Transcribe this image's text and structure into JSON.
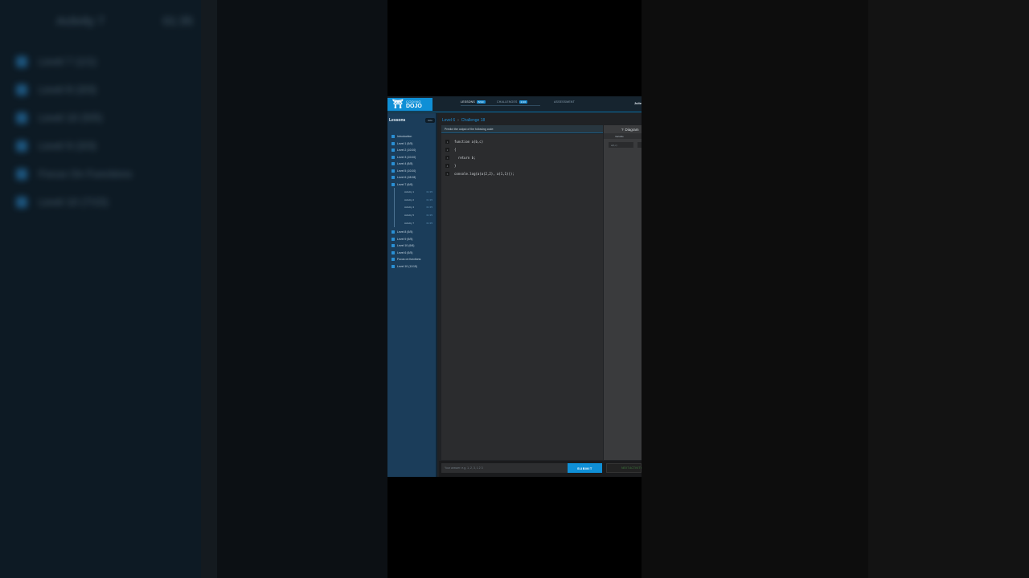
{
  "background_blur": {
    "title": "Activity 7",
    "title_time": "01:35",
    "items": [
      "Level 7 (1/1)",
      "Level 8 (3/3)",
      "Level 10 (5/5)",
      "Level 9 (3/3)",
      "Focus On Functions",
      "Level 10 (7/15)"
    ]
  },
  "header": {
    "logo_line1": "CODING",
    "logo_line2": "DOJO",
    "nav": [
      {
        "label": "LESSONS",
        "badge": "5/10"
      },
      {
        "label": "CHALLENGES",
        "badge": "1/10"
      },
      {
        "label": "ASSESSMENT",
        "badge": ""
      }
    ],
    "user": "Julie"
  },
  "sidebar": {
    "title": "Lessons",
    "pill": "Hide",
    "items": [
      "Introduction",
      "Level 1 (5/5)",
      "Level 2 (10/10)",
      "Level 3 (10/10)",
      "Level 4 (8/8)",
      "Level 5 (10/10)",
      "Level 6 (18/18)",
      "Level 7 (6/6)"
    ],
    "subitems": [
      {
        "label": "Activity 1",
        "time": "01:35"
      },
      {
        "label": "Activity 2",
        "time": "01:35"
      },
      {
        "label": "Activity 4",
        "time": "01:35"
      },
      {
        "label": "Activity 5",
        "time": "01:35"
      },
      {
        "label": "Activity 7",
        "time": "01:35"
      }
    ],
    "items_after": [
      "Level 8 (5/5)",
      "Level 9 (5/5)",
      "Level 10 (6/6)",
      "Level 6 (5/5)",
      "Focus on functions",
      "Level 10 (11/15)"
    ]
  },
  "main": {
    "breadcrumb": {
      "level": "Level 6",
      "separator": "›",
      "challenge": "Challenge 18"
    },
    "prompt": "Predict the output of the following code:",
    "code": [
      {
        "n": "1",
        "text": "function a(b,c)"
      },
      {
        "n": "2",
        "text": "{"
      },
      {
        "n": "3",
        "text": "  return b;"
      },
      {
        "n": "4",
        "text": "}"
      },
      {
        "n": "5",
        "text": "console.log(a(a(2,2), a(1,1)));"
      }
    ]
  },
  "diagram": {
    "tab_label": "Diagram",
    "tab_icon": "question-icon",
    "variable_label": "Variable",
    "cell_value": "a(b,c)"
  },
  "answer": {
    "placeholder": "Your answer: e.g. 1, 2, 3, 1 2 3",
    "submit_label": "SUBMIT",
    "next_label": "NEXT ACTIVITY"
  },
  "colors": {
    "accent": "#0f8fd6",
    "sidebar": "#1b3d5a",
    "editor": "#2b2c2e"
  }
}
